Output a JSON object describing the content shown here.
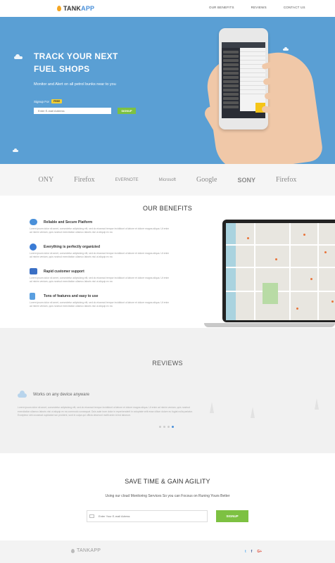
{
  "nav": {
    "logo_tank": "TANK",
    "logo_app": "APP",
    "links": [
      "OUR BENEFITS",
      "REVIEWS",
      "CONTACT US"
    ]
  },
  "hero": {
    "title_line1": "TRACK YOUR NEXT",
    "title_line2": "FUEL SHOPS",
    "subtitle": "Monitor and Alert on all petrol bunks near to you",
    "signup_label": "Signup For",
    "badge": "FREE",
    "input_placeholder": "Enter E-mail Address",
    "button": "SIGNUP"
  },
  "brands": [
    "ONY",
    "Firefox",
    "EVERNOTE",
    "Microsoft",
    "Google",
    "SONY",
    "Firefox"
  ],
  "benefits": {
    "title": "OUR BENEFITS",
    "items": [
      {
        "title": "Reliable and Secure Platform",
        "icon": "cloud-upload-icon",
        "color": "#4a90d9"
      },
      {
        "title": "Everything is perfectly organizied",
        "icon": "info-icon",
        "color": "#3a7bd5"
      },
      {
        "title": "Rapid customer support",
        "icon": "chat-icon",
        "color": "#3a6fc4"
      },
      {
        "title": "Tons of features and easy to use",
        "icon": "document-icon",
        "color": "#5a9fe0"
      }
    ],
    "body": "Lorem ipsum dolor sit amet, consectetur adipisicing elit, sed do eiusmod tempor incididunt ut labore et dolore magna aliqua. Ut enim ad minim veniam, quis nostrud exercitation ullamco laboris nisi ut aliquip ex ea"
  },
  "reviews": {
    "title": "REVIEWS",
    "heading": "Works on any device anyware",
    "text": "Lorem ipsum dolor sit amet, consectetur adipisicing elit, sed do eiusmod tempor incididunt ut labore et dolore magna aliqua. Ut enim ad minim veniam, quis nostrud exercitation ullamco laboris nisi ut aliquip ex ea commodo consequat. Duis aute irure dolor in reprehenderit in voluptate velit esse cillum dolore eu fugiat nulla pariatur. Excepteur sint occaecat cupidatat non proident, sunt in culpa qui officia deserunt mollit anim id est laborum."
  },
  "cta": {
    "title": "SAVE TIME & GAIN AGILITY",
    "subtitle": "Using our cloud Monitoring Services So you can Focous on Runing Yours Better",
    "input_placeholder": "Enter Your E-mail Adress",
    "button": "SIGNUP"
  },
  "footer": {
    "logo": "TANKAPP",
    "social": [
      {
        "glyph": "t",
        "icon": "twitter-icon",
        "color": "#55acee"
      },
      {
        "glyph": "f",
        "icon": "facebook-icon",
        "color": "#3b5998"
      },
      {
        "glyph": "G+",
        "icon": "google-plus-icon",
        "color": "#dd4b39"
      }
    ]
  },
  "colors": {
    "hero_bg": "#5a9fd4",
    "accent_green": "#7dc142",
    "accent_blue": "#4a90d9",
    "badge_yellow": "#f5d033"
  }
}
